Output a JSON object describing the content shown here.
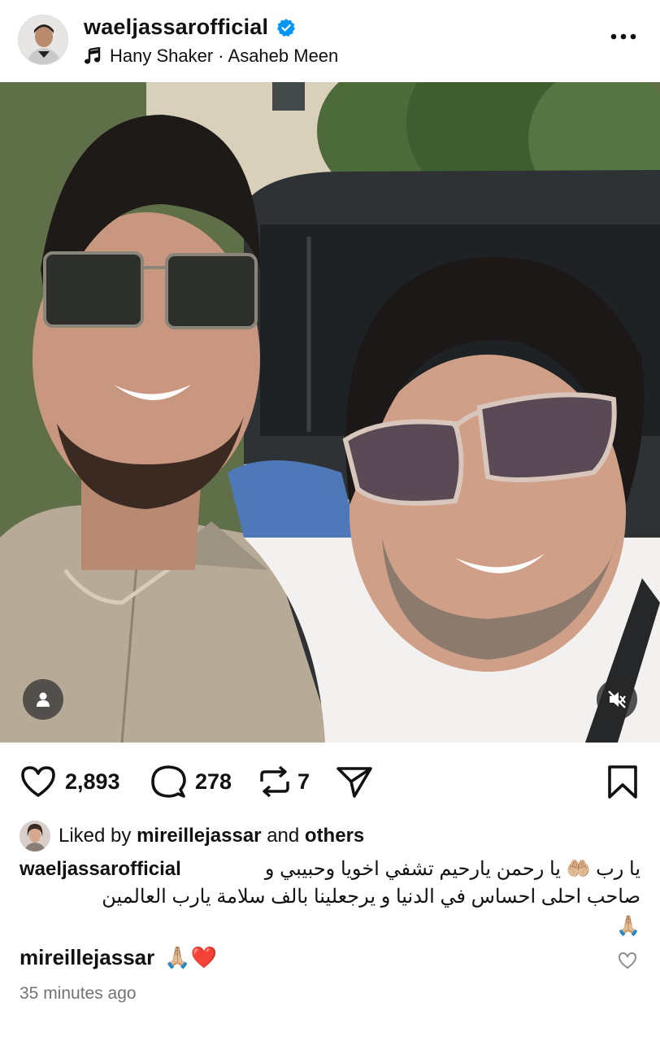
{
  "header": {
    "username": "waeljassarofficial",
    "music": "Hany Shaker · Asaheb Meen"
  },
  "actions": {
    "likes": "2,893",
    "comments": "278",
    "reposts": "7"
  },
  "liked_by": {
    "prefix": "Liked by",
    "user": "mireillejassar",
    "and": "and",
    "others": "others"
  },
  "caption": {
    "username": "waeljassarofficial",
    "line1": "يا رب 🤲🏼 يا رحمن يارحيم تشفي اخويا وحبيبي و",
    "line2": "صاحب احلى احساس في الدنيا  و يرجعلينا  بالف سلامة يارب العالمين",
    "line3": "🙏🏼"
  },
  "comment": {
    "username": "mireillejassar",
    "text": "🙏🏼❤️"
  },
  "timestamp": "35 minutes ago",
  "colors": {
    "verified": "#0095f6",
    "text": "#111111",
    "muted": "#737373"
  }
}
